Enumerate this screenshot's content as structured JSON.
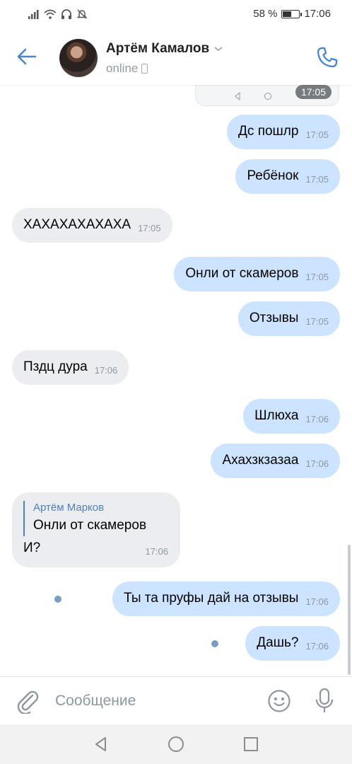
{
  "status_bar": {
    "battery_text": "58 %",
    "battery_level": 0.58,
    "clock": "17:06",
    "icons": [
      "signal-icon",
      "wifi-icon",
      "headset-icon",
      "mute-icon",
      "battery-icon"
    ]
  },
  "header": {
    "contact_name": "Артём Камалов",
    "status": "online"
  },
  "chat": {
    "partial_time": "17:05",
    "messages": [
      {
        "dir": "out",
        "text": "Дс пошлр",
        "time": "17:05"
      },
      {
        "dir": "out",
        "text": "Ребёнок",
        "time": "17:05"
      },
      {
        "dir": "in",
        "text": "ХАХАХАХАХАХА",
        "time": "17:05"
      },
      {
        "dir": "out",
        "text": "Онли от скамеров",
        "time": "17:05"
      },
      {
        "dir": "out",
        "text": "Отзывы",
        "time": "17:05"
      },
      {
        "dir": "in",
        "text": "Пздц дура",
        "time": "17:06"
      },
      {
        "dir": "out",
        "text": "Шлюха",
        "time": "17:06"
      },
      {
        "dir": "out",
        "text": "Ахахзкзазаа",
        "time": "17:06"
      },
      {
        "dir": "in",
        "reply_author": "Артём Марков",
        "reply_text": "Онли от скамеров",
        "text": "И?",
        "time": "17:06"
      },
      {
        "dir": "out",
        "text": "Ты та пруфы дай на отзывы",
        "time": "17:06",
        "unread": true
      },
      {
        "dir": "out",
        "text": "Дашь?",
        "time": "17:06",
        "unread": true
      }
    ]
  },
  "composer": {
    "placeholder": "Сообщение"
  },
  "colors": {
    "accent": "#4986cc",
    "outgoing_bubble": "#cce4ff",
    "incoming_bubble": "#ebedf0",
    "timestamp": "#8e98a4",
    "reply_author": "#5181b8"
  }
}
